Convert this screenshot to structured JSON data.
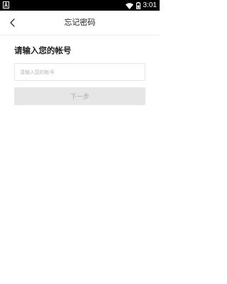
{
  "status_bar": {
    "time": "3:01",
    "icons": [
      "notification-a-icon",
      "wifi-icon",
      "battery-icon"
    ]
  },
  "header": {
    "title": "忘记密码",
    "back_icon": "chevron-left-icon"
  },
  "form": {
    "prompt": "请输入您的帐号",
    "account_value": "",
    "account_placeholder": "请输入您的帐号",
    "next_label": "下一步"
  },
  "colors": {
    "status_bar_bg": "#000000",
    "background": "#ffffff",
    "title_text": "#222222",
    "divider": "#ececec",
    "input_border": "#e6e6e6",
    "placeholder": "#b5b5b5",
    "button_disabled_bg": "#e6e6e6",
    "button_disabled_text": "#a9a9a9"
  }
}
